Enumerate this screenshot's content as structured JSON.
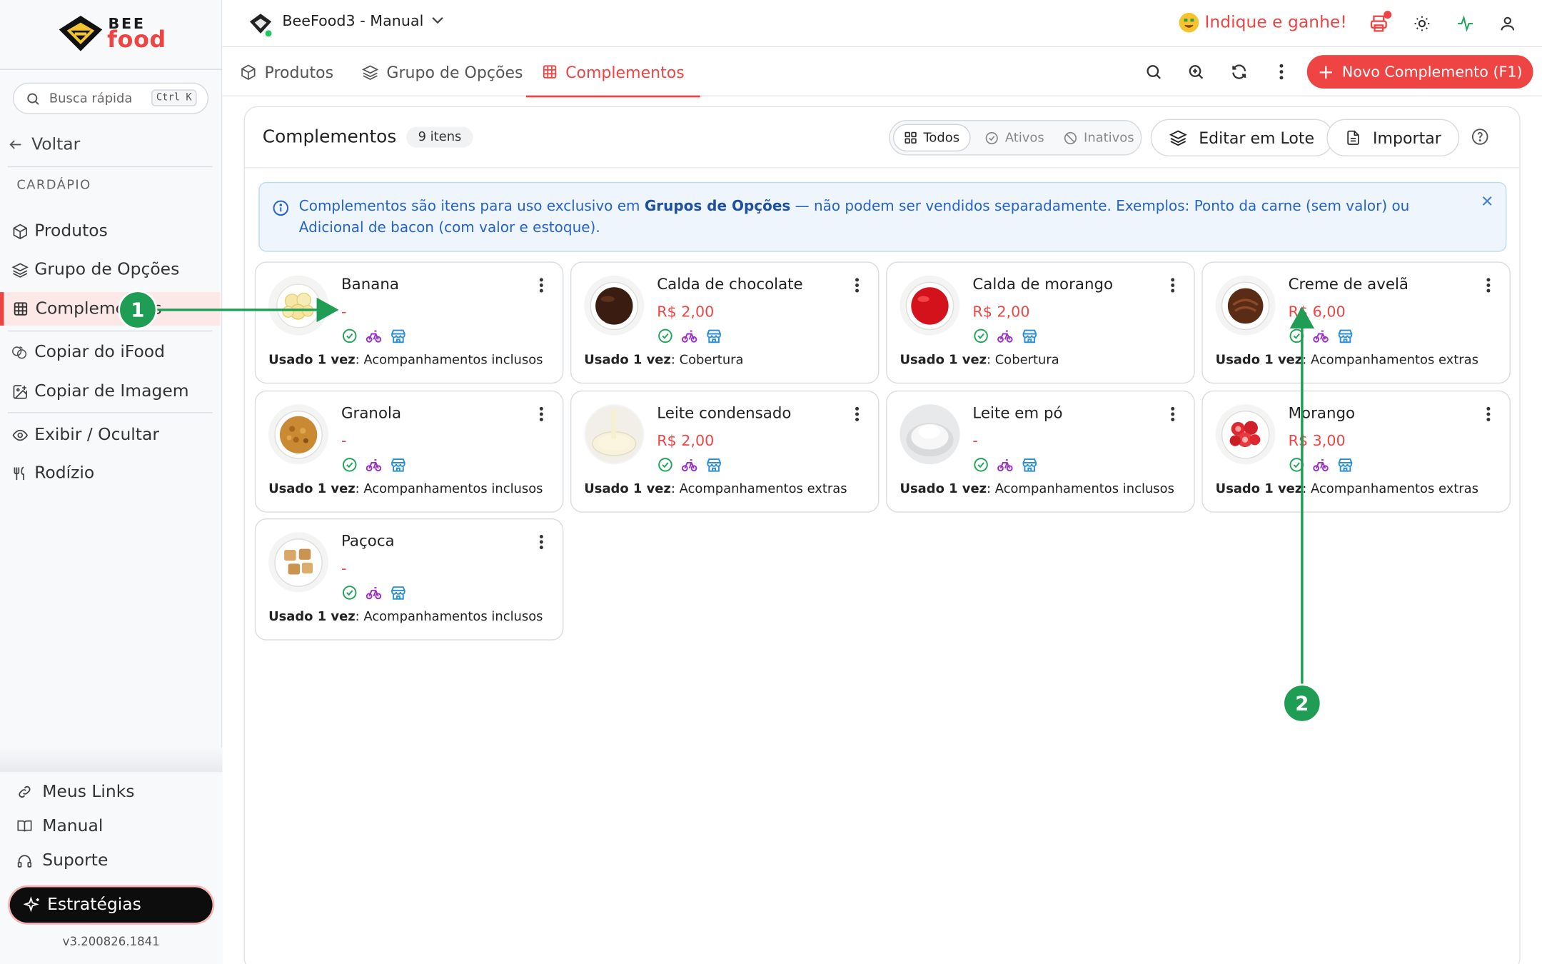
{
  "sidebar": {
    "logo": {
      "line1": "BEE",
      "line2": "food"
    },
    "search": {
      "placeholder": "Busca rápida",
      "shortcut": "Ctrl K"
    },
    "back_label": "Voltar",
    "section_label": "CARDÁPIO",
    "items": [
      {
        "label": "Produtos",
        "icon": "box-icon"
      },
      {
        "label": "Grupo de Opções",
        "icon": "layers-icon"
      },
      {
        "label": "Complementos",
        "icon": "table-icon",
        "active": true
      },
      {
        "label": "Copiar do iFood",
        "icon": "copy-ifood-icon"
      },
      {
        "label": "Copiar de Imagem",
        "icon": "image-edit-icon"
      },
      {
        "label": "Exibir / Ocultar",
        "icon": "eye-icon"
      },
      {
        "label": "Rodízio",
        "icon": "utensils-icon"
      }
    ],
    "bottom_items": [
      {
        "label": "Meus Links",
        "icon": "link-icon"
      },
      {
        "label": "Manual",
        "icon": "book-icon"
      },
      {
        "label": "Suporte",
        "icon": "headset-icon"
      }
    ],
    "strategies_label": "Estratégias",
    "version": "v3.200826.1841"
  },
  "topbar": {
    "store_name": "BeeFood3 - Manual",
    "referral_label": "Indique e ganhe!"
  },
  "tabs": [
    {
      "label": "Produtos",
      "icon": "box-icon"
    },
    {
      "label": "Grupo de Opções",
      "icon": "layers-icon"
    },
    {
      "label": "Complementos",
      "icon": "table-icon",
      "active": true
    }
  ],
  "new_button_label": "Novo Complemento (F1)",
  "panel": {
    "title": "Complementos",
    "count": "9 itens",
    "filters": [
      {
        "label": "Todos",
        "active": true
      },
      {
        "label": "Ativos"
      },
      {
        "label": "Inativos"
      }
    ],
    "batch_edit_label": "Editar em Lote",
    "import_label": "Importar",
    "info": {
      "part1": "Complementos são itens para uso exclusivo em ",
      "bold": "Grupos de Opções",
      "part2": " — não podem ser vendidos separadamente. Exemplos: Ponto da carne (sem valor) ou Adicional de bacon (com valor e estoque)."
    }
  },
  "usage_prefix": "Usado 1 vez",
  "items": [
    {
      "name": "Banana",
      "price": "-",
      "group": "Acompanhamentos inclusos",
      "food": "banana"
    },
    {
      "name": "Calda de chocolate",
      "price": "R$ 2,00",
      "group": "Cobertura",
      "food": "chocolate"
    },
    {
      "name": "Calda de morango",
      "price": "R$ 2,00",
      "group": "Cobertura",
      "food": "strawberry-sauce"
    },
    {
      "name": "Creme de avelã",
      "price": "R$ 6,00",
      "group": "Acompanhamentos extras",
      "food": "hazelnut"
    },
    {
      "name": "Granola",
      "price": "-",
      "group": "Acompanhamentos inclusos",
      "food": "granola"
    },
    {
      "name": "Leite condensado",
      "price": "R$ 2,00",
      "group": "Acompanhamentos extras",
      "food": "condensed-milk"
    },
    {
      "name": "Leite em pó",
      "price": "-",
      "group": "Acompanhamentos inclusos",
      "food": "milk-powder"
    },
    {
      "name": "Morango",
      "price": "R$ 3,00",
      "group": "Acompanhamentos extras",
      "food": "strawberries"
    },
    {
      "name": "Paçoca",
      "price": "-",
      "group": "Acompanhamentos inclusos",
      "food": "pacoca"
    }
  ],
  "annotations": [
    "1",
    "2"
  ],
  "colors": {
    "accent": "#ef4444",
    "active_green": "#22a55a",
    "delivery_purple": "#9b30c8",
    "store_blue": "#2b8fd6",
    "annotation": "#1f9d55"
  }
}
